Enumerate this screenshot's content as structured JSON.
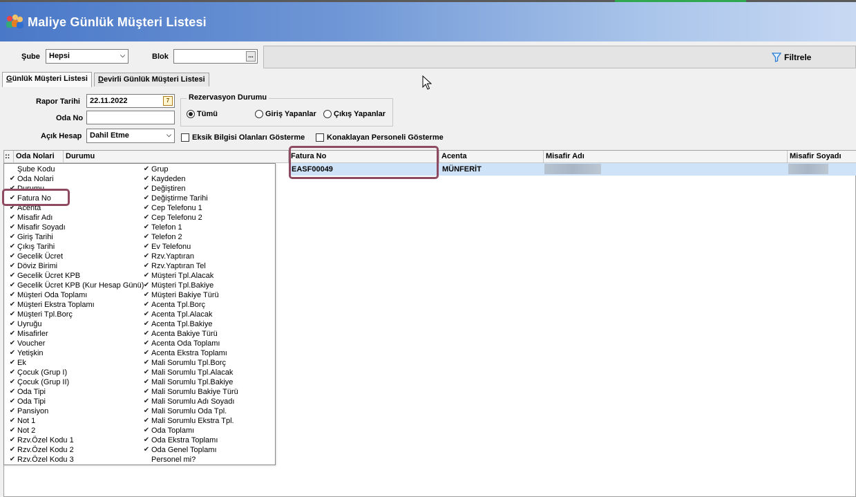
{
  "window": {
    "title": "Maliye Günlük Müşteri Listesi"
  },
  "toolbar": {
    "sube_label": "Şube",
    "sube_value": "Hepsi",
    "blok_label": "Blok",
    "blok_value": "",
    "filter_label": "Filtrele"
  },
  "tabs": [
    {
      "label_u": "G",
      "label_rest": "ünlük Müşteri Listesi",
      "active": true
    },
    {
      "label_u": "D",
      "label_rest": "evirli Günlük Müşteri Listesi",
      "active": false
    }
  ],
  "form": {
    "rapor_tarihi_label": "Rapor Tarihi",
    "rapor_tarihi_value": "22.11.2022",
    "oda_no_label": "Oda No",
    "oda_no_value": "",
    "acik_hesap_label": "Açık Hesap",
    "acik_hesap_value": "Dahil Etme",
    "rez_group_label": "Rezervasyon Durumu",
    "rez_options": [
      "Tümü",
      "Giriş Yapanlar",
      "Çıkış Yapanlar"
    ],
    "eksik_label": "Eksik Bilgisi Olanları Gösterme",
    "konak_label": "Konaklayan Personeli Gösterme",
    "calendar_icon_text": "7"
  },
  "grid": {
    "headers": [
      "::",
      "Oda Nolari",
      "Durumu",
      "Fatura No",
      "Acenta",
      "Misafir Adı",
      "Misafir Soyadı"
    ],
    "row": {
      "fatura_no": "EASF00049",
      "acenta": "MÜNFERİT"
    }
  },
  "column_menu": {
    "left": [
      {
        "label": "Şube Kodu",
        "checked": false
      },
      {
        "label": "Oda Nolari",
        "checked": true
      },
      {
        "label": "Durumu",
        "checked": true
      },
      {
        "label": "Fatura No",
        "checked": true
      },
      {
        "label": "Acenta",
        "checked": true
      },
      {
        "label": "Misafir Adı",
        "checked": true
      },
      {
        "label": "Misafir Soyadı",
        "checked": true
      },
      {
        "label": "Giriş Tarihi",
        "checked": true
      },
      {
        "label": "Çıkış Tarihi",
        "checked": true
      },
      {
        "label": "Gecelik Ücret",
        "checked": true
      },
      {
        "label": "Döviz Birimi",
        "checked": true
      },
      {
        "label": "Gecelik Ücret KPB",
        "checked": true
      },
      {
        "label": "Gecelik Ücret KPB (Kur Hesap Günü)",
        "checked": true
      },
      {
        "label": "Müşteri Oda Toplamı",
        "checked": true
      },
      {
        "label": "Müşteri Ekstra Toplamı",
        "checked": true
      },
      {
        "label": "Müşteri Tpl.Borç",
        "checked": true
      },
      {
        "label": "Uyruğu",
        "checked": true
      },
      {
        "label": "Misafirler",
        "checked": true
      },
      {
        "label": "Voucher",
        "checked": true
      },
      {
        "label": "Yetişkin",
        "checked": true
      },
      {
        "label": "Ek",
        "checked": true
      },
      {
        "label": "Çocuk (Grup I)",
        "checked": true
      },
      {
        "label": "Çocuk (Grup II)",
        "checked": true
      },
      {
        "label": "Oda Tipi",
        "checked": true
      },
      {
        "label": "Oda Tipi",
        "checked": true
      },
      {
        "label": "Pansiyon",
        "checked": true
      },
      {
        "label": "Not 1",
        "checked": true
      },
      {
        "label": "Not 2",
        "checked": true
      },
      {
        "label": "Rzv.Özel Kodu 1",
        "checked": true
      },
      {
        "label": "Rzv.Özel Kodu 2",
        "checked": true
      },
      {
        "label": "Rzv.Özel Kodu 3",
        "checked": true
      }
    ],
    "right": [
      {
        "label": "Grup",
        "checked": true
      },
      {
        "label": "Kaydeden",
        "checked": true
      },
      {
        "label": "Değiştiren",
        "checked": true
      },
      {
        "label": "Değiştirme Tarihi",
        "checked": true
      },
      {
        "label": "Cep Telefonu 1",
        "checked": true
      },
      {
        "label": "Cep Telefonu 2",
        "checked": true
      },
      {
        "label": "Telefon 1",
        "checked": true
      },
      {
        "label": "Telefon 2",
        "checked": true
      },
      {
        "label": "Ev Telefonu",
        "checked": true
      },
      {
        "label": "Rzv.Yaptıran",
        "checked": true
      },
      {
        "label": "Rzv.Yaptıran Tel",
        "checked": true
      },
      {
        "label": "Müşteri Tpl.Alacak",
        "checked": true
      },
      {
        "label": "Müşteri Tpl.Bakiye",
        "checked": true
      },
      {
        "label": "Müşteri Bakiye Türü",
        "checked": true
      },
      {
        "label": "Acenta Tpl.Borç",
        "checked": true
      },
      {
        "label": "Acenta Tpl.Alacak",
        "checked": true
      },
      {
        "label": "Acenta Tpl.Bakiye",
        "checked": true
      },
      {
        "label": "Acenta Bakiye Türü",
        "checked": true
      },
      {
        "label": "Acenta Oda Toplamı",
        "checked": true
      },
      {
        "label": "Acenta Ekstra Toplamı",
        "checked": true
      },
      {
        "label": "Mali Sorumlu Tpl.Borç",
        "checked": true
      },
      {
        "label": "Mali Sorumlu Tpl.Alacak",
        "checked": true
      },
      {
        "label": "Mali Sorumlu Tpl.Bakiye",
        "checked": true
      },
      {
        "label": "Mali Sorumlu Bakiye Türü",
        "checked": true
      },
      {
        "label": "Mali Sorumlu Adı Soyadı",
        "checked": true
      },
      {
        "label": "Mali Sorumlu Oda Tpl.",
        "checked": true
      },
      {
        "label": "Mali Sorumlu Ekstra Tpl.",
        "checked": true
      },
      {
        "label": "Oda Toplamı",
        "checked": true
      },
      {
        "label": "Oda Ekstra Toplamı",
        "checked": true
      },
      {
        "label": "Oda Genel Toplamı",
        "checked": true
      },
      {
        "label": "Personel mi?",
        "checked": false
      }
    ]
  },
  "colors": {
    "highlight": "#8e4a62",
    "selected_row": "#cfe3f8",
    "title_start": "#4a78c8"
  }
}
